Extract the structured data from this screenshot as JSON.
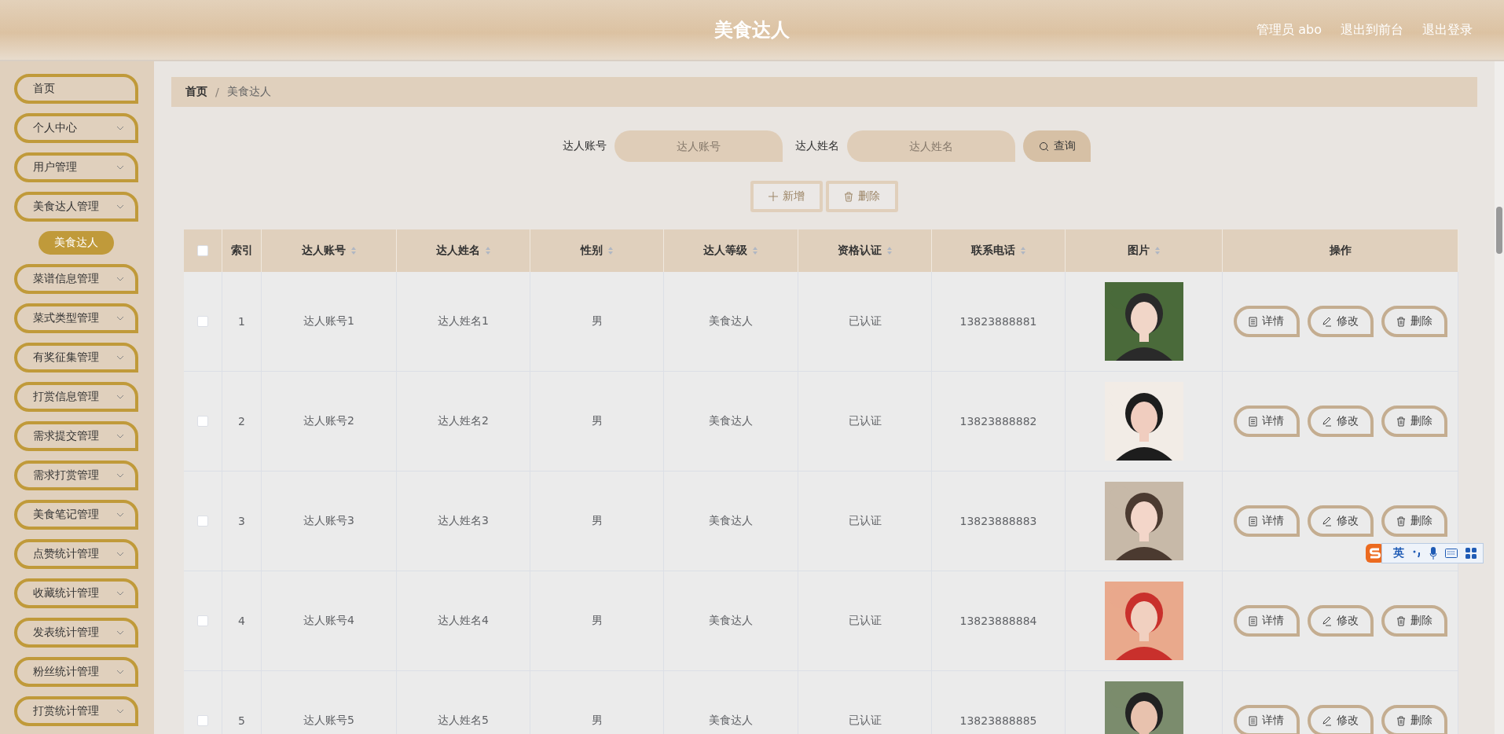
{
  "header": {
    "title": "美食达人",
    "links": [
      "管理员 abo",
      "退出到前台",
      "退出登录"
    ]
  },
  "sidebar": {
    "items": [
      {
        "label": "首页",
        "expandable": false
      },
      {
        "label": "个人中心",
        "expandable": true,
        "expanded": false
      },
      {
        "label": "用户管理",
        "expandable": true,
        "expanded": false
      },
      {
        "label": "美食达人管理",
        "expandable": true,
        "expanded": true,
        "children": [
          {
            "label": "美食达人",
            "selected": true
          }
        ]
      },
      {
        "label": "菜谱信息管理",
        "expandable": true,
        "expanded": false
      },
      {
        "label": "菜式类型管理",
        "expandable": true,
        "expanded": false
      },
      {
        "label": "有奖征集管理",
        "expandable": true,
        "expanded": false
      },
      {
        "label": "打赏信息管理",
        "expandable": true,
        "expanded": false
      },
      {
        "label": "需求提交管理",
        "expandable": true,
        "expanded": false
      },
      {
        "label": "需求打赏管理",
        "expandable": true,
        "expanded": false
      },
      {
        "label": "美食笔记管理",
        "expandable": true,
        "expanded": false
      },
      {
        "label": "点赞统计管理",
        "expandable": true,
        "expanded": false
      },
      {
        "label": "收藏统计管理",
        "expandable": true,
        "expanded": false
      },
      {
        "label": "发表统计管理",
        "expandable": true,
        "expanded": false
      },
      {
        "label": "粉丝统计管理",
        "expandable": true,
        "expanded": false
      },
      {
        "label": "打赏统计管理",
        "expandable": true,
        "expanded": false
      }
    ]
  },
  "breadcrumb": {
    "items": [
      "首页",
      "美食达人"
    ],
    "separator": "/"
  },
  "search": {
    "fields": [
      {
        "label": "达人账号",
        "placeholder": "达人账号"
      },
      {
        "label": "达人姓名",
        "placeholder": "达人姓名"
      }
    ],
    "button": "查询"
  },
  "actions": [
    {
      "label": "新增",
      "kind": "add",
      "disabled": true
    },
    {
      "label": "删除",
      "kind": "delete",
      "disabled": true
    }
  ],
  "table": {
    "all_checked": false,
    "columns": [
      {
        "label": "索引",
        "sortable": false
      },
      {
        "label": "达人账号",
        "sortable": true
      },
      {
        "label": "达人姓名",
        "sortable": true
      },
      {
        "label": "性别",
        "sortable": true
      },
      {
        "label": "达人等级",
        "sortable": true
      },
      {
        "label": "资格认证",
        "sortable": true
      },
      {
        "label": "联系电话",
        "sortable": true
      },
      {
        "label": "图片",
        "sortable": true
      },
      {
        "label": "操作",
        "sortable": false
      }
    ],
    "rows": [
      {
        "checked": false,
        "cells": [
          "1",
          "达人账号1",
          "达人姓名1",
          "男",
          "美食达人",
          "已认证",
          "13823888881"
        ],
        "actions": [
          {
            "label": "详情",
            "kind": "detail"
          },
          {
            "label": "修改",
            "kind": "edit"
          },
          {
            "label": "删除",
            "kind": "delete"
          }
        ]
      },
      {
        "checked": false,
        "cells": [
          "2",
          "达人账号2",
          "达人姓名2",
          "男",
          "美食达人",
          "已认证",
          "13823888882"
        ],
        "actions": [
          {
            "label": "详情",
            "kind": "detail"
          },
          {
            "label": "修改",
            "kind": "edit"
          },
          {
            "label": "删除",
            "kind": "delete"
          }
        ]
      },
      {
        "checked": false,
        "cells": [
          "3",
          "达人账号3",
          "达人姓名3",
          "男",
          "美食达人",
          "已认证",
          "13823888883"
        ],
        "actions": [
          {
            "label": "详情",
            "kind": "detail"
          },
          {
            "label": "修改",
            "kind": "edit"
          },
          {
            "label": "删除",
            "kind": "delete"
          }
        ]
      },
      {
        "checked": false,
        "cells": [
          "4",
          "达人账号4",
          "达人姓名4",
          "男",
          "美食达人",
          "已认证",
          "13823888884"
        ],
        "actions": [
          {
            "label": "详情",
            "kind": "detail"
          },
          {
            "label": "修改",
            "kind": "edit"
          },
          {
            "label": "删除",
            "kind": "delete"
          }
        ]
      },
      {
        "checked": false,
        "cells": [
          "5",
          "达人账号5",
          "达人姓名5",
          "男",
          "美食达人",
          "已认证",
          "13823888885"
        ],
        "actions": [
          {
            "label": "详情",
            "kind": "detail"
          },
          {
            "label": "修改",
            "kind": "edit"
          },
          {
            "label": "删除",
            "kind": "delete"
          }
        ]
      }
    ]
  },
  "ime_bar": {
    "mode": "英"
  }
}
